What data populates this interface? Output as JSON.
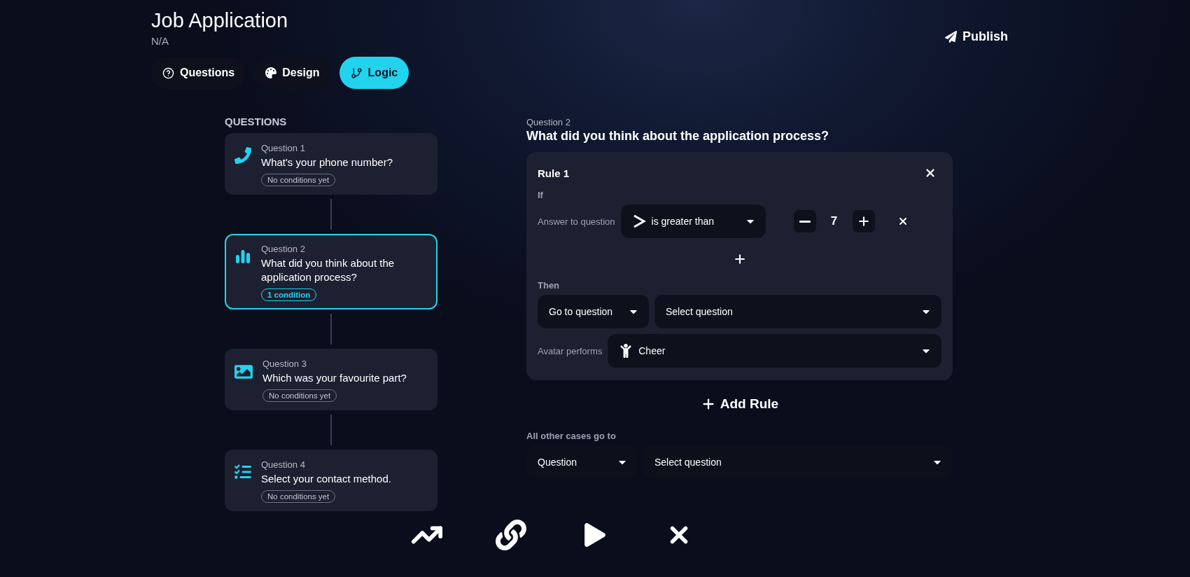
{
  "form": {
    "title": "Job Application",
    "subtitle": "N/A"
  },
  "publish_button": {
    "label": "Publish"
  },
  "tabs": [
    {
      "label": "Questions",
      "kind": "questions",
      "selected": false
    },
    {
      "label": "Design",
      "kind": "design",
      "selected": false
    },
    {
      "label": "Logic",
      "kind": "logic",
      "selected": true
    }
  ],
  "questions_panel": {
    "heading": "QUESTIONS",
    "items": [
      {
        "number": "Question 1",
        "text": "What's your phone number?",
        "kind": "phone",
        "badge": "No conditions yet",
        "has_conditions": false,
        "selected": false
      },
      {
        "number": "Question 2",
        "text": "What did you think about the application process?",
        "kind": "rating",
        "badge": "1 condition",
        "has_conditions": true,
        "selected": true
      },
      {
        "number": "Question 3",
        "text": "Which was your favourite part?",
        "kind": "image",
        "badge": "No conditions yet",
        "has_conditions": false,
        "selected": false
      },
      {
        "number": "Question 4",
        "text": "Select your contact method.",
        "kind": "choice",
        "badge": "No conditions yet",
        "has_conditions": false,
        "selected": false
      }
    ]
  },
  "editor": {
    "number": "Question 2",
    "title": "What did you think about the application process?",
    "rules": [
      {
        "title": "Rule 1",
        "if_label": "If",
        "conditions": [
          {
            "label": "Answer to question",
            "operator": "is greater than",
            "value": "7"
          }
        ],
        "then_label": "Then",
        "action": "Go to question",
        "target": "Select question",
        "avatar_label": "Avatar performs",
        "avatar_action": "Cheer"
      }
    ],
    "add_rule": "Add Rule",
    "fallback": {
      "label": "All other cases go to",
      "type": "Question",
      "target": "Select question"
    }
  },
  "toolbar": [
    {
      "kind": "analytics"
    },
    {
      "kind": "share"
    },
    {
      "kind": "preview"
    },
    {
      "kind": "close"
    }
  ]
}
